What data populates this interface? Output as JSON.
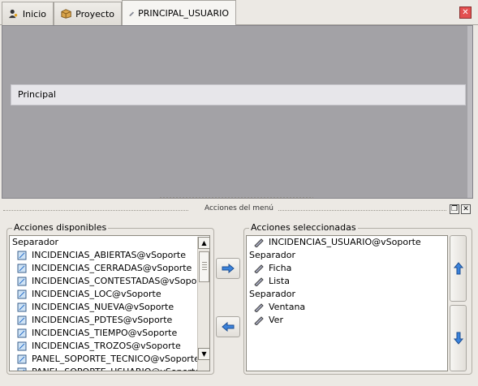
{
  "tabs": [
    {
      "label": "Inicio",
      "icon": "user-icon"
    },
    {
      "label": "Proyecto",
      "icon": "box-icon"
    },
    {
      "label": "PRINCIPAL_USUARIO",
      "icon": "menu-icon"
    }
  ],
  "main": {
    "menubar_label": "Principal"
  },
  "panel": {
    "title": "Acciones del menú"
  },
  "left": {
    "title": "Acciones disponibles",
    "items": [
      {
        "label": "Separador",
        "icon": ""
      },
      {
        "label": "INCIDENCIAS_ABIERTAS@vSoporte",
        "icon": "form-icon"
      },
      {
        "label": "INCIDENCIAS_CERRADAS@vSoporte",
        "icon": "form-icon"
      },
      {
        "label": "INCIDENCIAS_CONTESTADAS@vSoporte",
        "icon": "form-icon"
      },
      {
        "label": "INCIDENCIAS_LOC@vSoporte",
        "icon": "form-icon"
      },
      {
        "label": "INCIDENCIAS_NUEVA@vSoporte",
        "icon": "form-icon"
      },
      {
        "label": "INCIDENCIAS_PDTES@vSoporte",
        "icon": "form-icon"
      },
      {
        "label": "INCIDENCIAS_TIEMPO@vSoporte",
        "icon": "form-icon"
      },
      {
        "label": "INCIDENCIAS_TROZOS@vSoporte",
        "icon": "form-icon"
      },
      {
        "label": "PANEL_SOPORTE_TECNICO@vSoporte",
        "icon": "form-icon"
      },
      {
        "label": "PANEL_SOPORTE_USUARIO@vSoporte",
        "icon": "form-icon"
      }
    ]
  },
  "right": {
    "title": "Acciones seleccionadas",
    "items": [
      {
        "label": "INCIDENCIAS_USUARIO@vSoporte",
        "icon": "menu-icon"
      },
      {
        "label": "Separador",
        "icon": ""
      },
      {
        "label": "Ficha",
        "icon": "menu-icon"
      },
      {
        "label": "Lista",
        "icon": "menu-icon"
      },
      {
        "label": "Separador",
        "icon": ""
      },
      {
        "label": "Ventana",
        "icon": "menu-icon"
      },
      {
        "label": "Ver",
        "icon": "menu-icon"
      }
    ]
  },
  "colors": {
    "accent": "#2a6ec8",
    "main_bg": "#a3a2a6",
    "close": "#e35050"
  }
}
